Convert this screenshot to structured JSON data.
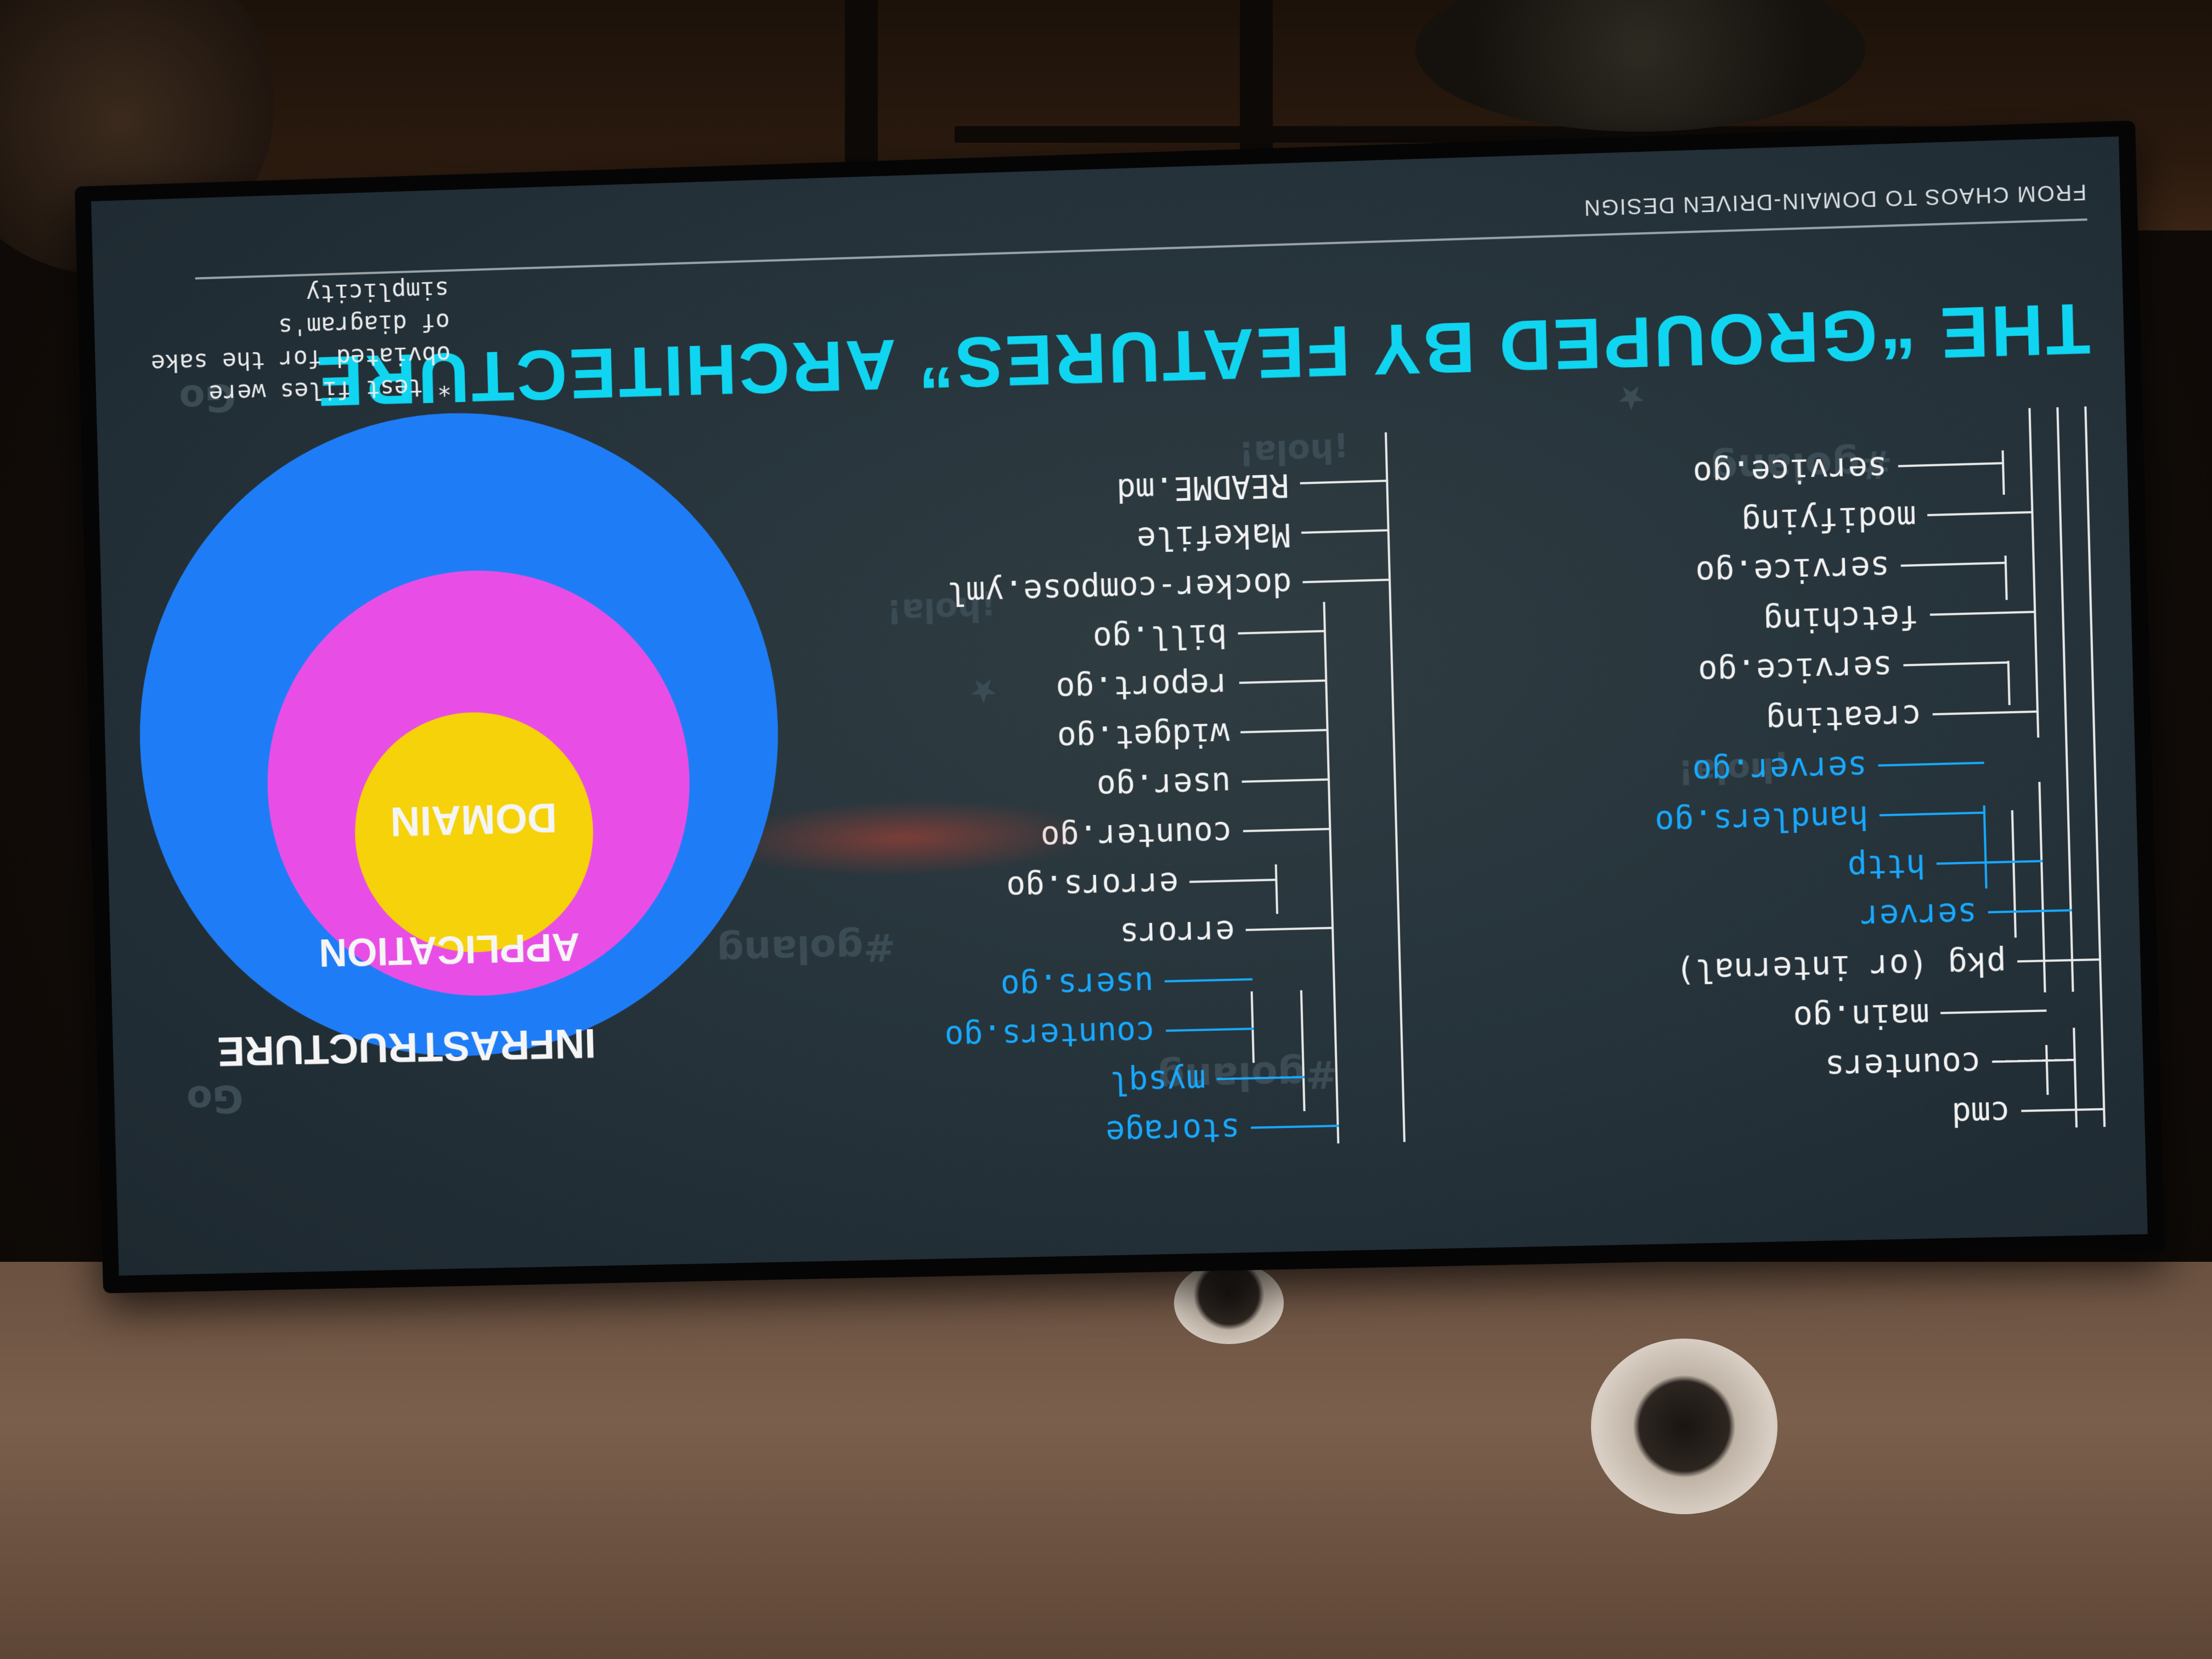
{
  "slide": {
    "footer": "FROM CHAOS TO DOMAIN-DRIVEN DESIGN",
    "title": "THE “GROUPED BY FEATURES” ARCHITECTURE",
    "note": "* test files were obviated for the sake of diagram's simplicity",
    "layers": {
      "outer": "INFRASTRUCTURE",
      "middle": "APPLICATION",
      "inner": "DOMAIN"
    },
    "tree_col1": [
      {
        "label": "cmd"
      },
      {
        "label": "counters"
      },
      {
        "label": "main.go"
      },
      {
        "label": "pkg (or internal)"
      },
      {
        "label": "server"
      },
      {
        "label": "http"
      },
      {
        "label": "handlers.go"
      },
      {
        "label": "server.go"
      },
      {
        "label": "creating"
      },
      {
        "label": "service.go"
      },
      {
        "label": "fetching"
      },
      {
        "label": "service.go"
      },
      {
        "label": "modifying"
      },
      {
        "label": "service.go"
      }
    ],
    "tree_col2": [
      {
        "label": "storage"
      },
      {
        "label": "mysql"
      },
      {
        "label": "counters.go"
      },
      {
        "label": "users.go"
      },
      {
        "label": "errors"
      },
      {
        "label": "errors.go"
      },
      {
        "label": "counter.go"
      },
      {
        "label": "user.go"
      },
      {
        "label": "widget.go"
      },
      {
        "label": "report.go"
      },
      {
        "label": "bill.go"
      },
      {
        "label": "docker-compose.yml"
      },
      {
        "label": "Makefile"
      },
      {
        "label": "README.md"
      }
    ],
    "doodles": [
      "#golang",
      "¡hola!",
      "Go",
      "#golang",
      "¡hola!",
      "Go",
      "¡hola!",
      "#golang"
    ]
  },
  "colors": {
    "title": "#10d5f0",
    "highlight": "#17a9ff",
    "infrastructure": "#1e7df6",
    "application": "#e84ee6",
    "domain": "#f5d20a",
    "background": "#25323a"
  }
}
